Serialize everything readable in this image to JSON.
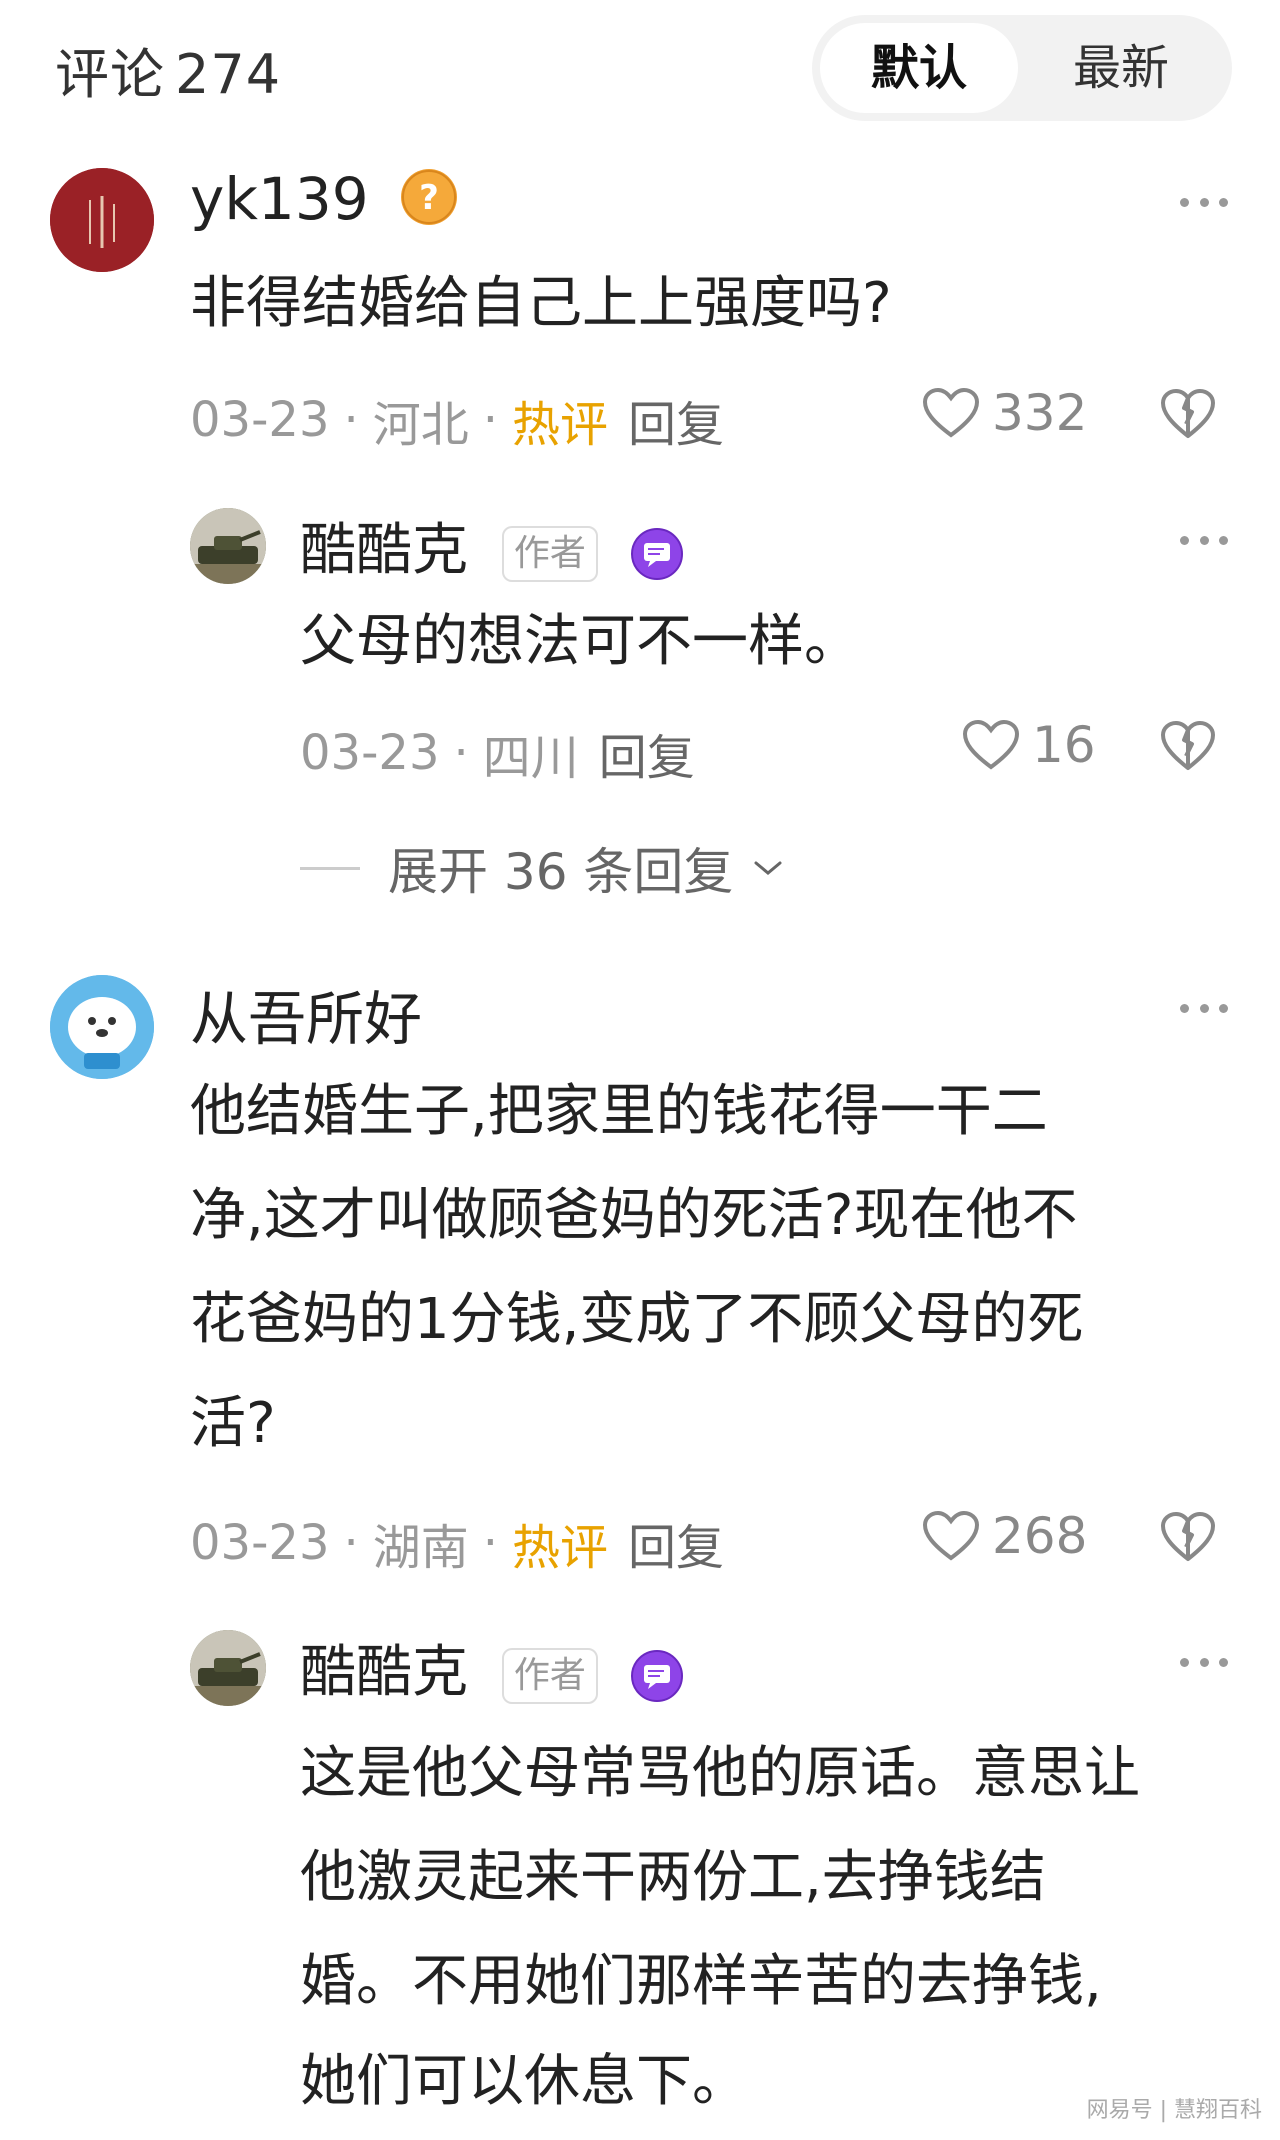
{
  "header": {
    "title": "评论",
    "count": "274",
    "sort_default": "默认",
    "sort_latest": "最新"
  },
  "comments": [
    {
      "user": "yk139",
      "text": "非得结婚给自己上上强度吗?",
      "date": "03-23",
      "location": "河北",
      "hot": "热评",
      "reply": "回复",
      "likes": "332",
      "reply_item": {
        "user": "酷酷克",
        "author_badge": "作者",
        "text": "父母的想法可不一样。",
        "date": "03-23",
        "location": "四川",
        "reply": "回复",
        "likes": "16"
      },
      "expand": "展开 36 条回复"
    },
    {
      "user": "从吾所好",
      "text_lines": [
        "他结婚生子,把家里的钱花得一干二",
        "净,这才叫做顾爸妈的死活?现在他不",
        "花爸妈的1分钱,变成了不顾父母的死",
        "活?"
      ],
      "date": "03-23",
      "location": "湖南",
      "hot": "热评",
      "reply": "回复",
      "likes": "268",
      "reply_item": {
        "user": "酷酷克",
        "author_badge": "作者",
        "text_lines": [
          "这是他父母常骂他的原话。意思让",
          "他激灵起来干两份工,去挣钱结",
          "婚。不用她们那样辛苦的去挣钱,",
          "她们可以休息下。"
        ]
      }
    }
  ],
  "watermark": "网易号 | 慧翔百科",
  "colors": {
    "hot": "#e8a200",
    "meta": "#999999",
    "level_badge": "#8e44e8",
    "question_badge": "#f0a030"
  }
}
